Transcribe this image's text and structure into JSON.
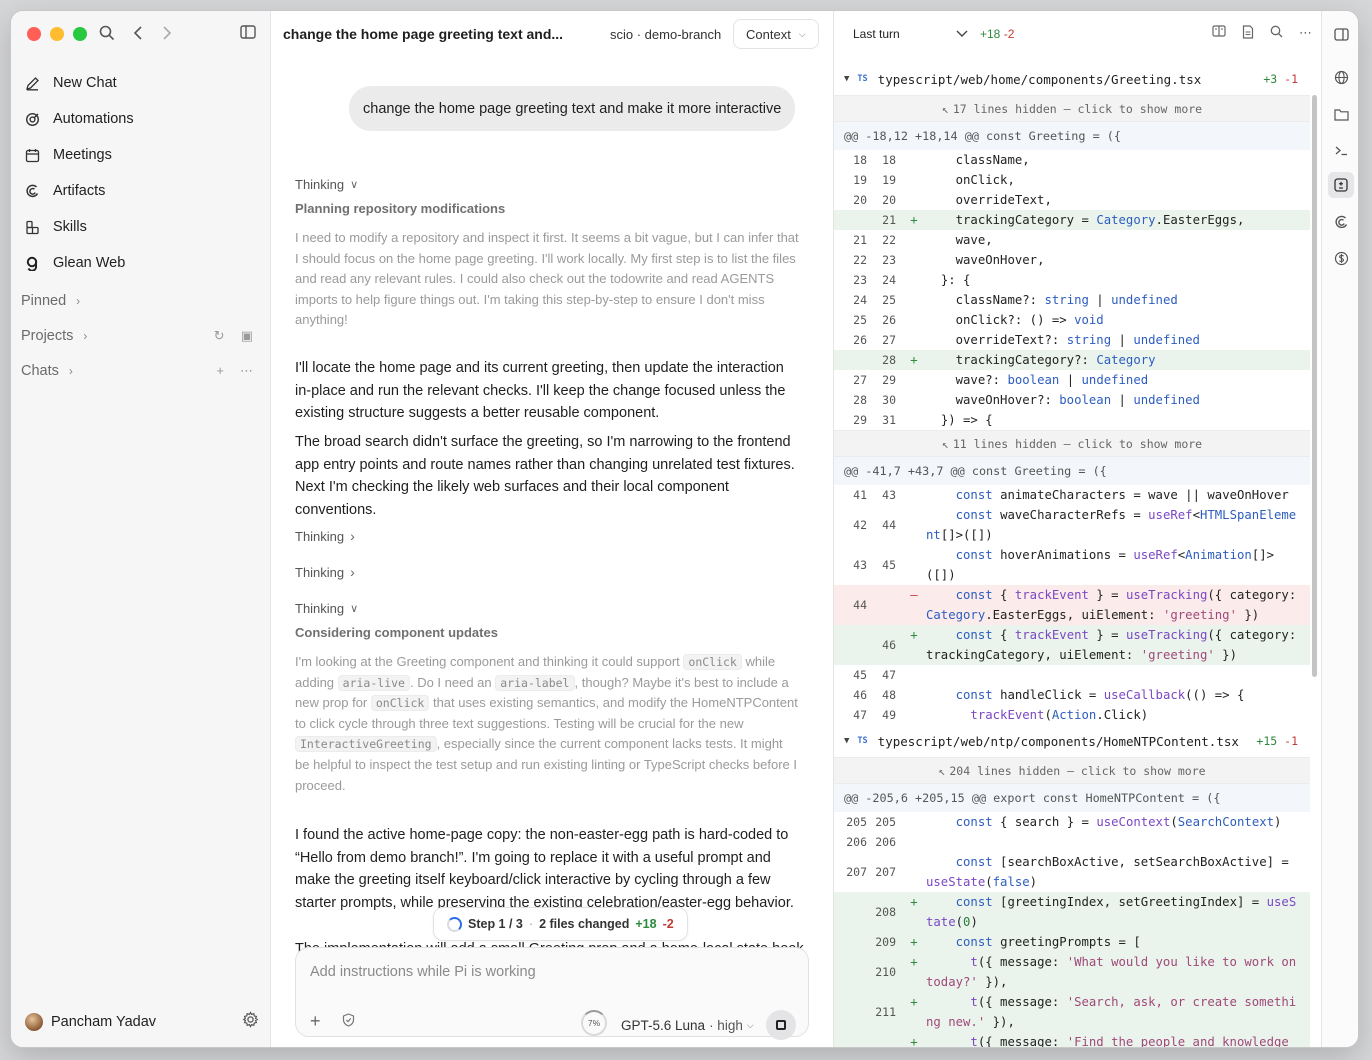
{
  "sidebar": {
    "nav": [
      {
        "label": "New Chat",
        "icon": "pencil-icon"
      },
      {
        "label": "Automations",
        "icon": "automation-icon"
      },
      {
        "label": "Meetings",
        "icon": "calendar-icon"
      },
      {
        "label": "Artifacts",
        "icon": "artifact-icon"
      },
      {
        "label": "Skills",
        "icon": "skills-icon"
      },
      {
        "label": "Glean Web",
        "icon": "glean-icon"
      }
    ],
    "sections": {
      "pinned": "Pinned",
      "projects": "Projects",
      "chats": "Chats"
    },
    "user": {
      "name": "Pancham Yadav"
    }
  },
  "chat": {
    "title": "change the home page greeting text and...",
    "repo": "scio · demo-branch",
    "context_label": "Context",
    "user_message": "change the home page greeting text and make it more interactive",
    "thinking_label": "Thinking",
    "thinking1_title": "Planning repository modifications",
    "thinking1_body": "I need to modify a repository and inspect it first. It seems a bit vague, but I can infer that I should focus on the home page greeting. I'll work locally. My first step is to list the files and read any relevant rules. I could also check out the todowrite and read AGENTS imports to help figure things out. I'm taking this step-by-step to ensure I don't miss anything!",
    "para1": "I'll locate the home page and its current greeting, then update the interaction in-place and run the relevant checks. I'll keep the change focused unless the existing structure suggests a better reusable component.",
    "para2": "The broad search didn't surface the greeting, so I'm narrowing to the frontend app entry points and route names rather than changing unrelated test fixtures. Next I'm checking the likely web surfaces and their local component conventions.",
    "thinking4_title": "Considering component updates",
    "thinking4_parts": {
      "a": "I'm looking at the Greeting component and thinking it could support ",
      "code1": "onClick",
      "b": " while adding ",
      "code2": "aria-live",
      "c": ". Do I need an ",
      "code3": "aria-label",
      "d": ", though? Maybe it's best to include a new prop for ",
      "code4": "onClick",
      "e": " that uses existing semantics, and modify the HomeNTPContent to click cycle through three text suggestions. Testing will be crucial for the new ",
      "code5": "InteractiveGreeting",
      "f": ", especially since the current component lacks tests. It might be helpful to inspect the test setup and run existing linting or TypeScript checks before I proceed."
    },
    "para3": "I found the active home-page copy: the non-easter-egg path is hard-coded to “Hello from demo branch!”. I'm going to replace it with a useful prompt and make the greeting itself keyboard/click interactive by cycling through a few starter prompts, while preserving the existing celebration/easter-egg behavior.",
    "para4_fragment": "The implementation will add a small Greeting prop and a home-local state hook so the",
    "status": {
      "step": "Step 1 / 3",
      "files": "2 files changed",
      "add": "+18",
      "del": "-2"
    },
    "composer": {
      "placeholder": "Add instructions while Pi is working",
      "percent": "7%",
      "model": "GPT-5.6 Luna",
      "effort": "· high"
    }
  },
  "diff": {
    "scope": "Last turn",
    "add": "+18",
    "del": "-2",
    "files": [
      {
        "path": "typescript/web/home/components/Greeting.tsx",
        "add": "+3",
        "del": "-1",
        "hidden_top": "17 lines hidden – click to show more",
        "hunk1": "@@ -18,12 +18,14 @@ const Greeting = ({",
        "hidden_mid": "11 lines hidden – click to show more",
        "hunk2": "@@ -41,7 +43,7 @@ const Greeting = ({"
      },
      {
        "path": "typescript/web/ntp/components/HomeNTPContent.tsx",
        "add": "+15",
        "del": "-1",
        "hidden_top": "204 lines hidden – click to show more",
        "hunk1": "@@ -205,6 +205,15 @@ export const HomeNTPContent = ({"
      }
    ],
    "lines1": [
      {
        "o": "18",
        "n": "18",
        "t": " ",
        "s": "    className,"
      },
      {
        "o": "19",
        "n": "19",
        "t": " ",
        "s": "    onClick,"
      },
      {
        "o": "20",
        "n": "20",
        "t": " ",
        "s": "    overrideText,"
      },
      {
        "o": "",
        "n": "21",
        "t": "+",
        "s": "    trackingCategory = Category.EasterEggs,"
      },
      {
        "o": "21",
        "n": "22",
        "t": " ",
        "s": "    wave,"
      },
      {
        "o": "22",
        "n": "23",
        "t": " ",
        "s": "    waveOnHover,"
      },
      {
        "o": "23",
        "n": "24",
        "t": " ",
        "s": "  }: {"
      },
      {
        "o": "24",
        "n": "25",
        "t": " ",
        "s": "    className?: string | undefined"
      },
      {
        "o": "25",
        "n": "26",
        "t": " ",
        "s": "    onClick?: () => void"
      },
      {
        "o": "26",
        "n": "27",
        "t": " ",
        "s": "    overrideText?: string | undefined"
      },
      {
        "o": "",
        "n": "28",
        "t": "+",
        "s": "    trackingCategory?: Category"
      },
      {
        "o": "27",
        "n": "29",
        "t": " ",
        "s": "    wave?: boolean | undefined"
      },
      {
        "o": "28",
        "n": "30",
        "t": " ",
        "s": "    waveOnHover?: boolean | undefined"
      },
      {
        "o": "29",
        "n": "31",
        "t": " ",
        "s": "  }) => {"
      }
    ],
    "lines2": [
      {
        "o": "41",
        "n": "43",
        "t": " ",
        "s": "    const animateCharacters = wave || waveOnHover"
      },
      {
        "o": "42",
        "n": "44",
        "t": " ",
        "s": "    const waveCharacterRefs = useRef<HTMLSpanElement[]>([])"
      },
      {
        "o": "43",
        "n": "45",
        "t": " ",
        "s": "    const hoverAnimations = useRef<Animation[]>([])"
      },
      {
        "o": "44",
        "n": "",
        "t": "-",
        "s": "    const { trackEvent } = useTracking({ category: Category.EasterEggs, uiElement: 'greeting' })"
      },
      {
        "o": "",
        "n": "46",
        "t": "+",
        "s": "    const { trackEvent } = useTracking({ category: trackingCategory, uiElement: 'greeting' })"
      },
      {
        "o": "45",
        "n": "47",
        "t": " ",
        "s": ""
      },
      {
        "o": "46",
        "n": "48",
        "t": " ",
        "s": "    const handleClick = useCallback(() => {"
      },
      {
        "o": "47",
        "n": "49",
        "t": " ",
        "s": "      trackEvent(Action.Click)"
      }
    ],
    "lines3": [
      {
        "o": "205",
        "n": "205",
        "t": " ",
        "s": "    const { search } = useContext(SearchContext)"
      },
      {
        "o": "206",
        "n": "206",
        "t": " ",
        "s": ""
      },
      {
        "o": "207",
        "n": "207",
        "t": " ",
        "s": "    const [searchBoxActive, setSearchBoxActive] = useState(false)"
      },
      {
        "o": "",
        "n": "208",
        "t": "+",
        "s": "    const [greetingIndex, setGreetingIndex] = useState(0)"
      },
      {
        "o": "",
        "n": "209",
        "t": "+",
        "s": "    const greetingPrompts = ["
      },
      {
        "o": "",
        "n": "210",
        "t": "+",
        "s": "      t({ message: 'What would you like to work on today?' }),"
      },
      {
        "o": "",
        "n": "211",
        "t": "+",
        "s": "      t({ message: 'Search, ask, or create something new.' }),"
      },
      {
        "o": "",
        "n": "212",
        "t": "+",
        "s": "      t({ message: 'Find the people and knowledge you need.' }),"
      }
    ]
  }
}
